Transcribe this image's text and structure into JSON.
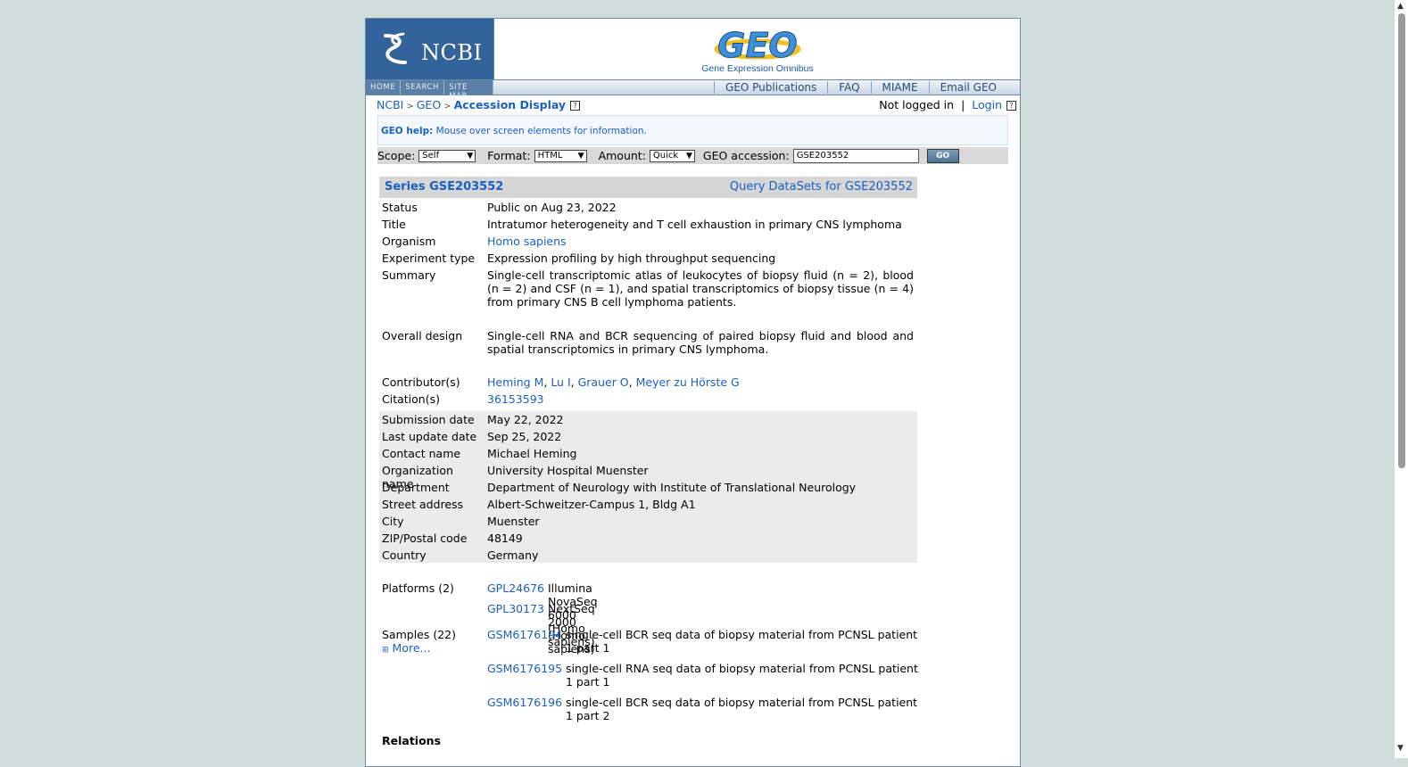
{
  "banner": {
    "ncbi_label": "NCBI",
    "geo_logo_text": "GEO",
    "geo_subtitle": "Gene Expression Omnibus"
  },
  "nav": {
    "small_links": [
      "HOME",
      "SEARCH",
      "SITE MAP"
    ],
    "links": [
      "GEO Publications",
      "FAQ",
      "MIAME",
      "Email GEO"
    ]
  },
  "breadcrumb": {
    "items": [
      "NCBI",
      "GEO"
    ],
    "current": "Accession Display",
    "separator": ">"
  },
  "login": {
    "status": "Not logged in",
    "divider": "|",
    "login_label": "Login"
  },
  "help": {
    "label": "GEO help:",
    "text": "Mouse over screen elements for information."
  },
  "query": {
    "scope_label": "Scope:",
    "scope_value": "Self",
    "format_label": "Format:",
    "format_value": "HTML",
    "amount_label": "Amount:",
    "amount_value": "Quick",
    "accession_label": "GEO accession:",
    "accession_value": "GSE203552",
    "go_label": "GO"
  },
  "series": {
    "title": "Series GSE203552",
    "query_link": "Query DataSets for GSE203552",
    "status_label": "Status",
    "status": "Public on Aug 23, 2022",
    "title_label": "Title",
    "title_value": "Intratumor heterogeneity and T cell exhaustion in primary CNS lymphoma",
    "organism_label": "Organism",
    "organism": "Homo sapiens",
    "experiment_label": "Experiment type",
    "experiment_type": "Expression profiling by high throughput sequencing",
    "summary_label": "Summary",
    "summary": "Single-cell transcriptomic atlas of leukocytes of biopsy fluid (n = 2), blood (n = 2) and CSF (n = 1), and spatial transcriptomics of biopsy tissue (n = 4) from primary CNS B cell lymphoma patients.",
    "design_label": "Overall design",
    "overall_design": "Single-cell RNA and BCR sequencing of paired biopsy fluid and blood and spatial transcriptomics in primary CNS lymphoma.",
    "contributors_label": "Contributor(s)",
    "contributors": [
      "Heming M",
      "Lu I",
      "Grauer O",
      "Meyer zu Hörste G"
    ],
    "citation_label": "Citation(s)",
    "citation": "36153593",
    "submission_label": "Submission date",
    "submission_date": "May 22, 2022",
    "update_label": "Last update date",
    "last_update": "Sep 25, 2022",
    "contact_label": "Contact name",
    "contact_name": "Michael Heming",
    "org_label": "Organization name",
    "organization": "University Hospital Muenster",
    "dept_label": "Department",
    "department": "Department of Neurology with Institute of Translational Neurology",
    "street_label": "Street address",
    "street": "Albert-Schweitzer-Campus 1, Bldg A1",
    "city_label": "City",
    "city": "Muenster",
    "zip_label": "ZIP/Postal code",
    "zip": "48149",
    "country_label": "Country",
    "country": "Germany",
    "platforms_label": "Platforms (2)",
    "platforms": [
      {
        "id": "GPL24676",
        "desc": "Illumina NovaSeq 6000 (Homo sapiens)"
      },
      {
        "id": "GPL30173",
        "desc": "NextSeq 2000 (Homo sapiens)"
      }
    ],
    "samples_label": "Samples (22)",
    "more_label": "More...",
    "samples": [
      {
        "id": "GSM6176194",
        "desc_line1": "single-cell BCR seq data of biopsy material from PCNSL patient",
        "desc_line2": "1 part 1"
      },
      {
        "id": "GSM6176195",
        "desc_line1": "single-cell RNA seq data of biopsy material from PCNSL patient",
        "desc_line2": "1 part 1"
      },
      {
        "id": "GSM6176196",
        "desc_line1": "single-cell BCR seq data of biopsy material from PCNSL patient",
        "desc_line2": "1 part 2"
      }
    ],
    "relations_label": "Relations"
  }
}
